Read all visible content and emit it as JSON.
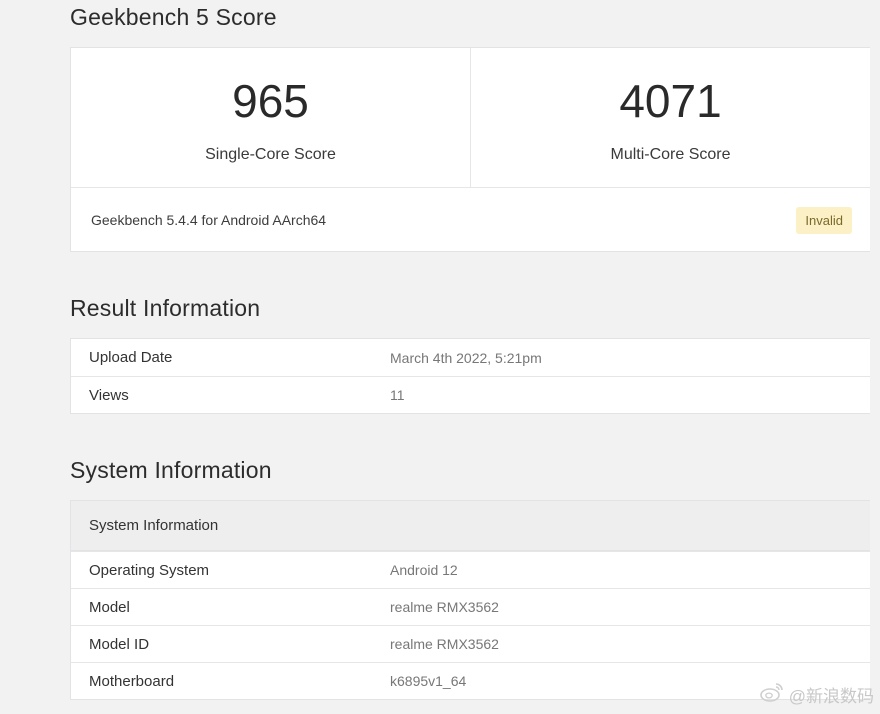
{
  "sections": {
    "score_title": "Geekbench 5 Score",
    "result_title": "Result Information",
    "system_title": "System Information"
  },
  "scores": {
    "single_core_value": "965",
    "single_core_label": "Single-Core Score",
    "multi_core_value": "4071",
    "multi_core_label": "Multi-Core Score",
    "version": "Geekbench 5.4.4 for Android AArch64",
    "status_badge": "Invalid"
  },
  "result_info": {
    "rows": [
      {
        "key": "Upload Date",
        "value": "March 4th 2022, 5:21pm"
      },
      {
        "key": "Views",
        "value": "11"
      }
    ]
  },
  "system_info": {
    "header": "System Information",
    "rows": [
      {
        "key": "Operating System",
        "value": "Android 12"
      },
      {
        "key": "Model",
        "value": "realme RMX3562"
      },
      {
        "key": "Model ID",
        "value": "realme RMX3562"
      },
      {
        "key": "Motherboard",
        "value": "k6895v1_64"
      }
    ]
  },
  "watermark": {
    "text": "@新浪数码",
    "icon": "weibo-icon"
  },
  "colors": {
    "background": "#f2f2f3",
    "card": "#ffffff",
    "badge_bg": "#fbf0c6",
    "badge_text": "#7a6a2a"
  }
}
